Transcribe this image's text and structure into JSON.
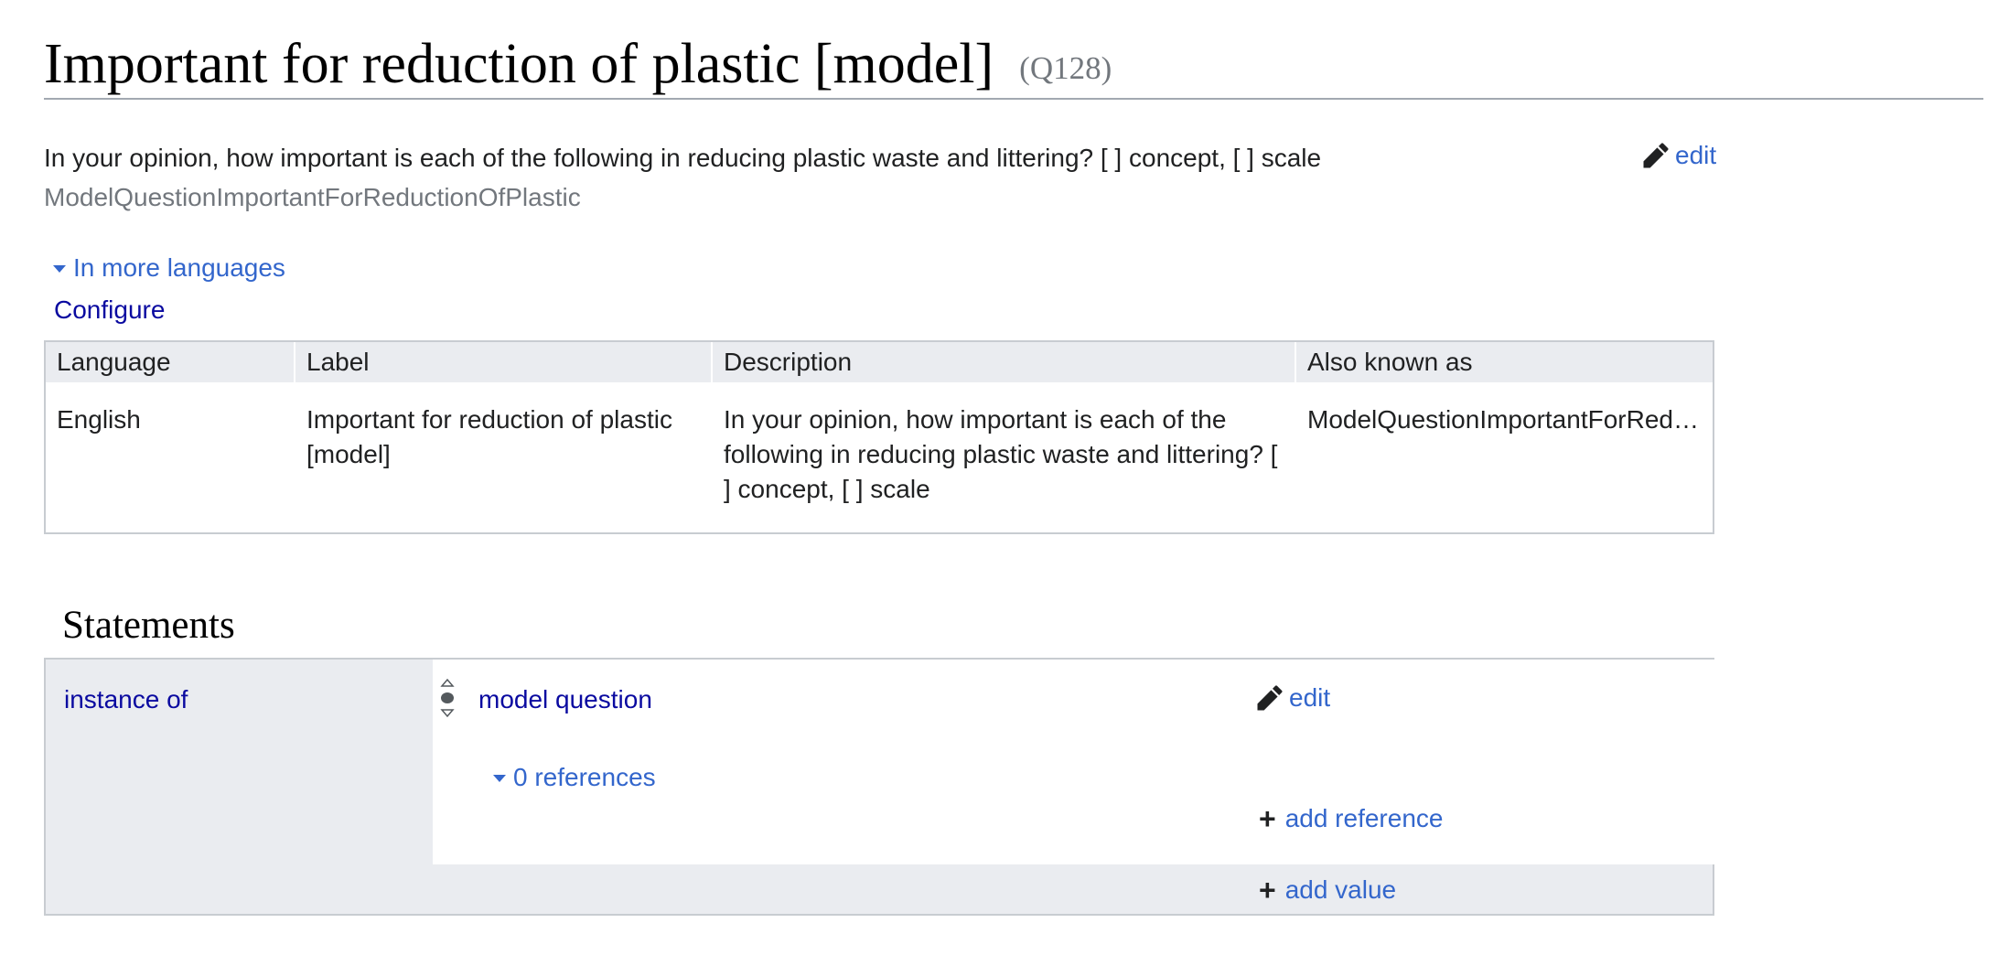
{
  "header": {
    "title": "Important for reduction of plastic [model]",
    "entity_id": "(Q128)"
  },
  "entity": {
    "description": "In your opinion, how important is each of the following in reducing plastic waste and littering? [ ] concept, [ ] scale",
    "alias": "ModelQuestionImportantForReductionOfPlastic",
    "edit_label": "edit"
  },
  "languages": {
    "toggle_label": "In more languages",
    "configure_label": "Configure",
    "columns": [
      "Language",
      "Label",
      "Description",
      "Also known as"
    ],
    "rows": [
      {
        "language": "English",
        "label": "Important for reduction of plastic [model]",
        "description": "In your opinion, how important is each of the following in reducing plastic waste and littering? [ ] concept, [ ] scale",
        "also_known_as": "ModelQuestionImportantForReductionOfPlastic"
      }
    ]
  },
  "statements": {
    "heading": "Statements",
    "items": [
      {
        "property": "instance of",
        "value": "model question",
        "edit_label": "edit",
        "references_label": "0 references",
        "add_reference_label": "add reference",
        "add_value_label": "add value"
      }
    ]
  },
  "colors": {
    "link": "#3366cc",
    "link_visited": "#0a0aa0",
    "header_bg": "#eaecf0",
    "border": "#c8ccd1",
    "muted": "#72777d"
  },
  "icons": {
    "edit": "pencil-icon",
    "expand": "triangle-down-icon",
    "rank": "rank-normal-icon",
    "add": "plus-icon"
  }
}
